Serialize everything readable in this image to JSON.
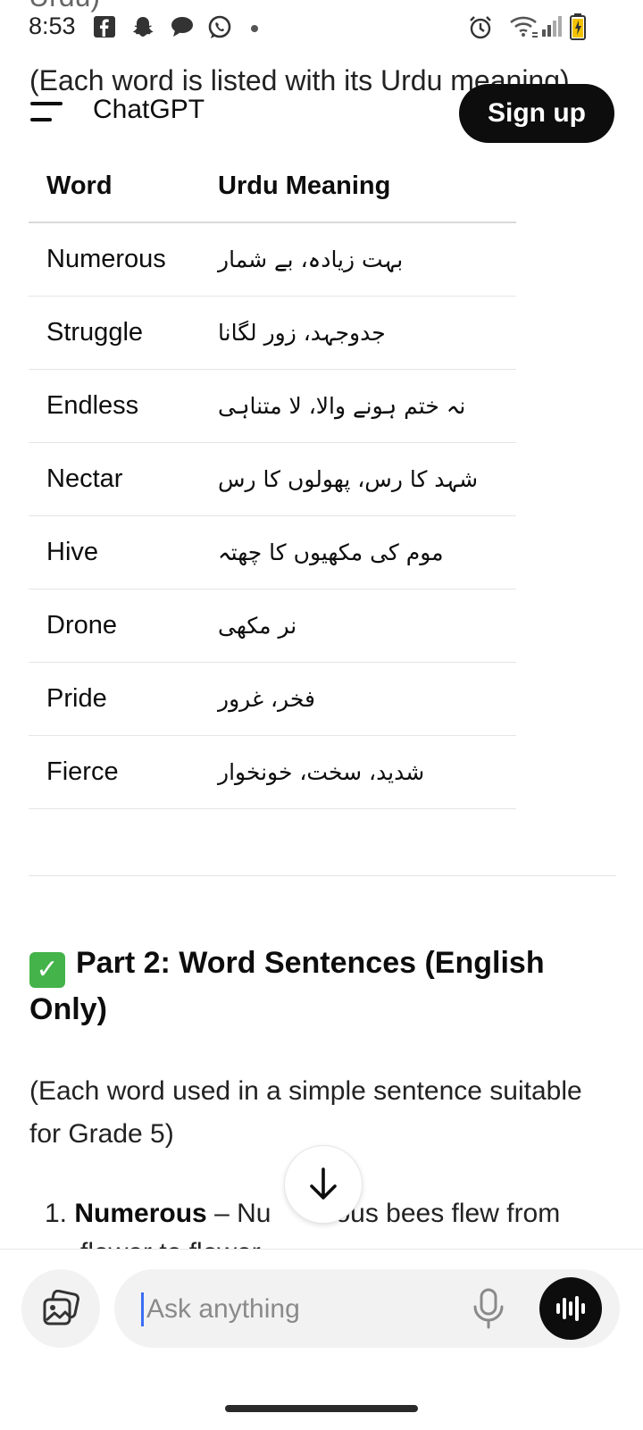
{
  "status_bar": {
    "time": "8:53",
    "icons": [
      "facebook-icon",
      "snapchat-icon",
      "chat-bubble-icon",
      "whatsapp-icon",
      "dot-icon",
      "alarm-icon",
      "wifi-icon",
      "signal-icon",
      "battery-charging-icon"
    ]
  },
  "page": {
    "cut_text": "Urdu)",
    "intro": "(Each word is listed with its Urdu meaning)"
  },
  "header": {
    "menu_icon": "menu-icon",
    "title": "ChatGPT",
    "signup_label": "Sign up"
  },
  "table": {
    "headers": [
      "Word",
      "Urdu Meaning"
    ],
    "rows": [
      {
        "word": "Numerous",
        "urdu": "بہت زیادہ، بے شمار"
      },
      {
        "word": "Struggle",
        "urdu": "جدوجہد، زور لگانا"
      },
      {
        "word": "Endless",
        "urdu": "نہ ختم ہونے والا، لا متناہی"
      },
      {
        "word": "Nectar",
        "urdu": "شہد کا رس، پھولوں کا رس"
      },
      {
        "word": "Hive",
        "urdu": "موم کی مکھیوں کا چھتہ"
      },
      {
        "word": "Drone",
        "urdu": "نر مکھی"
      },
      {
        "word": "Pride",
        "urdu": "فخر، غرور"
      },
      {
        "word": "Fierce",
        "urdu": "شدید، سخت، خونخوار"
      }
    ]
  },
  "section": {
    "check_icon": "check-mark-icon",
    "heading": "Part 2: Word Sentences (English Only)",
    "paragraph": "(Each word used in a simple sentence suitable for Grade 5)",
    "list_number": "1.",
    "list_word": "Numerous",
    "list_dash": " – ",
    "list_text_start": "Nu",
    "list_text_end": "ous bees flew from",
    "list_next_line": "flower to flower."
  },
  "scroll_button_icon": "arrow-down-icon",
  "composer": {
    "placeholder": "Ask anything",
    "attach_icon": "image-attach-icon",
    "mic_icon": "microphone-icon",
    "voice_icon": "voice-mode-icon"
  },
  "colors": {
    "accent_black": "#0d0d0d",
    "check_green": "#44b34a",
    "cursor_blue": "#3b6ef5"
  }
}
